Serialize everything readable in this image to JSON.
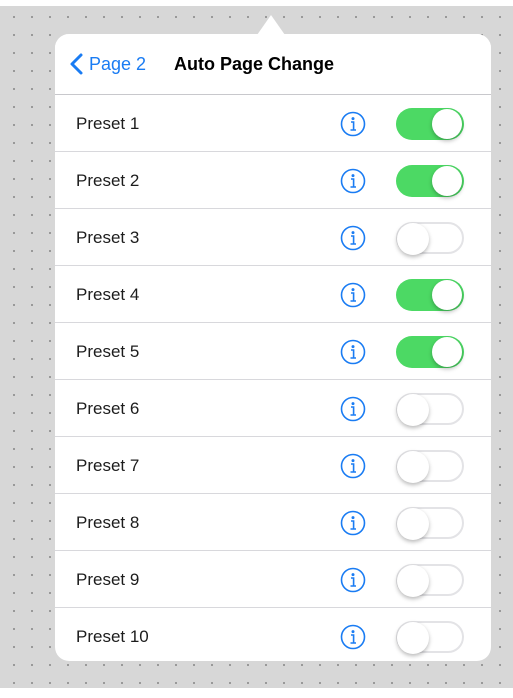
{
  "colors": {
    "accent": "#1a7cf3",
    "switch_on": "#4cd964",
    "switch_off_border": "#e3e3e6"
  },
  "nav": {
    "back_label": "Page 2",
    "back_icon": "chevron-left-icon",
    "title": "Auto Page Change"
  },
  "presets": [
    {
      "label": "Preset 1",
      "enabled": true
    },
    {
      "label": "Preset 2",
      "enabled": true
    },
    {
      "label": "Preset 3",
      "enabled": false
    },
    {
      "label": "Preset 4",
      "enabled": true
    },
    {
      "label": "Preset 5",
      "enabled": true
    },
    {
      "label": "Preset 6",
      "enabled": false
    },
    {
      "label": "Preset 7",
      "enabled": false
    },
    {
      "label": "Preset 8",
      "enabled": false
    },
    {
      "label": "Preset 9",
      "enabled": false
    },
    {
      "label": "Preset 10",
      "enabled": false
    }
  ],
  "row_icons": {
    "info": "info-icon"
  }
}
